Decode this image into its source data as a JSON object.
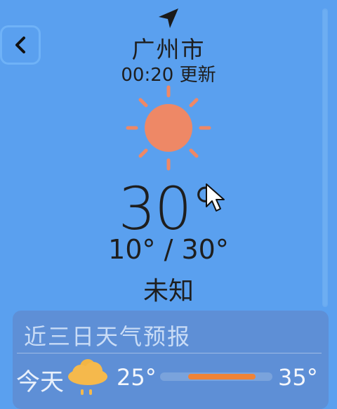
{
  "header": {
    "city": "广州市",
    "updated": "00:20 更新"
  },
  "current": {
    "temperature": "30°",
    "range": "10° / 30°",
    "condition": "未知",
    "icon": "sun-icon"
  },
  "forecast": {
    "title": "近三日天气预报",
    "days": [
      {
        "day": "今天",
        "low": "25°",
        "high": "35°",
        "icon": "cloud-rain-sun-icon",
        "bar_fill": 0.6
      }
    ]
  },
  "colors": {
    "background": "#5aa0ef",
    "sun": "#ee8866",
    "forecast_bar_fill": "#ef8337"
  }
}
